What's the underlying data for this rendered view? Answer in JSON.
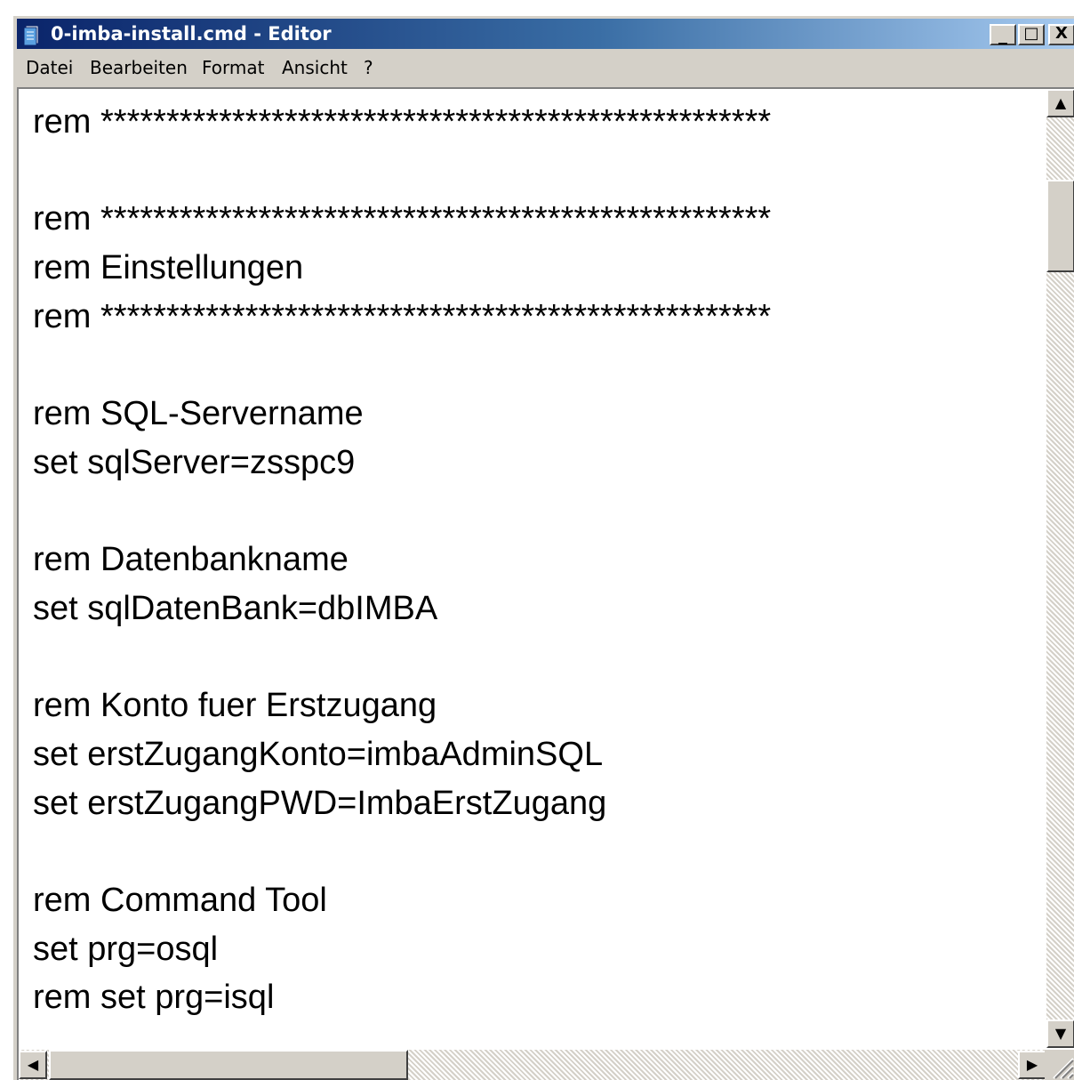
{
  "window": {
    "title": "0-imba-install.cmd - Editor",
    "minimize_label": "_",
    "maximize_label": "□",
    "close_label": "X"
  },
  "menu": {
    "items": [
      "Datei",
      "Bearbeiten",
      "Format",
      "Ansicht",
      "?"
    ]
  },
  "editor": {
    "lines": [
      "rem ***************************************************",
      "",
      "rem ***************************************************",
      "rem Einstellungen",
      "rem ***************************************************",
      "",
      "rem SQL-Servername",
      "set sqlServer=zsspc9",
      "",
      "rem Datenbankname",
      "set sqlDatenBank=dbIMBA",
      "",
      "rem Konto fuer Erstzugang",
      "set erstZugangKonto=imbaAdminSQL",
      "set erstZugangPWD=ImbaErstZugang",
      "",
      "rem Command Tool",
      "set prg=osql",
      "rem set prg=isql"
    ]
  },
  "scrollbar": {
    "up_arrow": "▲",
    "down_arrow": "▼",
    "left_arrow": "◀",
    "right_arrow": "▶"
  },
  "colors": {
    "titlebar_start": "#0a246a",
    "titlebar_end": "#a6caf0",
    "chrome": "#d4d0c8"
  }
}
